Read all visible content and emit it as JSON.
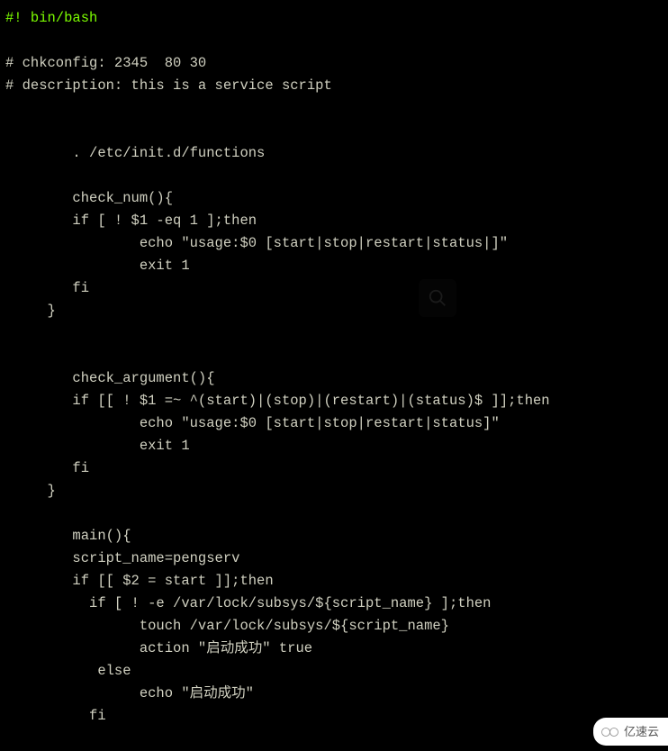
{
  "code": {
    "line1": "#! bin/bash",
    "line2": "",
    "line3": "# chkconfig: 2345  80 30",
    "line4": "# description: this is a service script",
    "line5": "",
    "line6": "",
    "line7": "        . /etc/init.d/functions",
    "line8": "",
    "line9": "        check_num(){",
    "line10": "        if [ ! $1 -eq 1 ];then",
    "line11": "                echo \"usage:$0 [start|stop|restart|status|]\"",
    "line12": "                exit 1",
    "line13": "        fi",
    "line14": "     }",
    "line15": "",
    "line16": "",
    "line17": "        check_argument(){",
    "line18": "        if [[ ! $1 =~ ^(start)|(stop)|(restart)|(status)$ ]];then",
    "line19": "                echo \"usage:$0 [start|stop|restart|status]\"",
    "line20": "                exit 1",
    "line21": "        fi",
    "line22": "     }",
    "line23": "",
    "line24": "        main(){",
    "line25": "        script_name=pengserv",
    "line26": "        if [[ $2 = start ]];then",
    "line27": "          if [ ! -e /var/lock/subsys/${script_name} ];then",
    "line28": "                touch /var/lock/subsys/${script_name}",
    "line29": "                action \"启动成功\" true",
    "line30": "           else",
    "line31": "                echo \"启动成功\"",
    "line32": "          fi"
  },
  "watermark": {
    "logo_text": "亿速云"
  }
}
